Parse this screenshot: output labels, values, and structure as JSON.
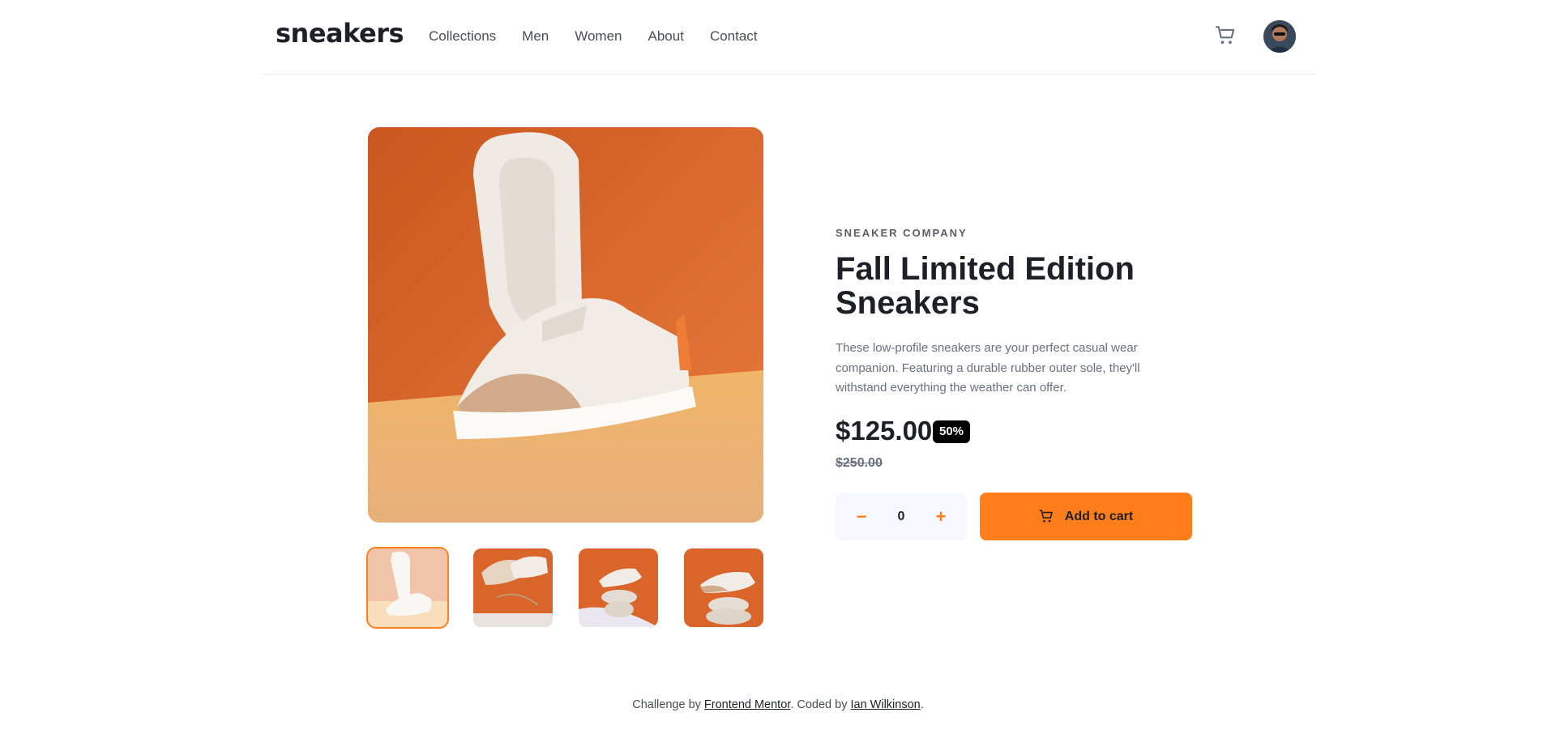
{
  "brand": {
    "logo": "sneakers",
    "accent": "#ff7d1a"
  },
  "nav": {
    "items": [
      {
        "label": "Collections"
      },
      {
        "label": "Men"
      },
      {
        "label": "Women"
      },
      {
        "label": "About"
      },
      {
        "label": "Contact"
      }
    ]
  },
  "header": {
    "cart_icon": "cart-icon",
    "avatar": "user-avatar"
  },
  "gallery": {
    "selected_index": 0,
    "thumb_count": 4
  },
  "product": {
    "company": "SNEAKER COMPANY",
    "title": "Fall Limited Edition Sneakers",
    "description": "These low-profile sneakers are your perfect casual wear companion. Featuring a durable rubber outer sole, they'll withstand everything the weather can offer.",
    "price": "$125.00",
    "discount": "50%",
    "original_price": "$250.00"
  },
  "quantity": {
    "minus": "−",
    "value": "0",
    "plus": "+"
  },
  "add_to_cart": {
    "label": "Add to cart"
  },
  "footer": {
    "prefix": "Challenge by ",
    "link1": "Frontend Mentor",
    "middle": ". Coded by ",
    "link2": "Ian Wilkinson",
    "suffix": "."
  }
}
